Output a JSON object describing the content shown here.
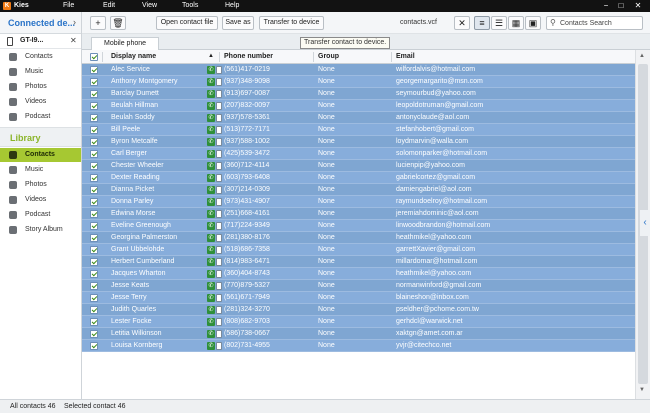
{
  "app": {
    "logo_text": "K",
    "name": "Kies"
  },
  "menu": [
    "File",
    "Edit",
    "View",
    "Tools",
    "Help"
  ],
  "window": {
    "minimize": "−",
    "maximize": "□",
    "close": "✕"
  },
  "sidebar": {
    "connected_title": "Connected de...",
    "device_name": "GT-I9...",
    "device_items": [
      "Contacts",
      "Music",
      "Photos",
      "Videos",
      "Podcast"
    ],
    "library_title": "Library",
    "library_items": [
      "Contacts",
      "Music",
      "Photos",
      "Videos",
      "Podcast",
      "Story Album"
    ]
  },
  "toolbar": {
    "add": "+",
    "delete": "🗑",
    "open_contact_file": "Open contact file",
    "save_as": "Save as",
    "transfer_to_device": "Transfer to device",
    "file_name": "contacts.vcf",
    "search_placeholder": "Contacts Search"
  },
  "tooltip": "Transfer contact to device.",
  "tab": "Mobile phone",
  "table": {
    "headers": {
      "display_name": "Display name",
      "phone_number": "Phone number",
      "group": "Group",
      "email": "Email"
    },
    "rows": [
      {
        "name": "Alec Service",
        "phone": "(561)417-0219",
        "group": "None",
        "email": "wilfordalvis@hotmail.com"
      },
      {
        "name": "Anthony Montgomery",
        "phone": "(937)348-9098",
        "group": "None",
        "email": "georgemargarito@msn.com"
      },
      {
        "name": "Barclay Dumett",
        "phone": "(913)697-0087",
        "group": "None",
        "email": "seymourbud@yahoo.com"
      },
      {
        "name": "Beulah Hillman",
        "phone": "(207)832-0097",
        "group": "None",
        "email": "leopoldotruman@gmail.com"
      },
      {
        "name": "Beulah Soddy",
        "phone": "(937)578-5361",
        "group": "None",
        "email": "antonyclaude@aol.com"
      },
      {
        "name": "Bill Peele",
        "phone": "(513)772-7171",
        "group": "None",
        "email": "stefanhobert@gmail.com"
      },
      {
        "name": "Byron Metcalfe",
        "phone": "(937)588-1002",
        "group": "None",
        "email": "loydmarvin@walla.com"
      },
      {
        "name": "Carl Berger",
        "phone": "(425)539-3472",
        "group": "None",
        "email": "solomonparker@hotmail.com"
      },
      {
        "name": "Chester Wheeler",
        "phone": "(360)712-4114",
        "group": "None",
        "email": "lucienpip@yahoo.com"
      },
      {
        "name": "Dexter Reading",
        "phone": "(603)793-6408",
        "group": "None",
        "email": "gabrielcortez@gmail.com"
      },
      {
        "name": "Dianna Picket",
        "phone": "(307)214-0309",
        "group": "None",
        "email": "damiengabriel@aol.com"
      },
      {
        "name": "Donna Parley",
        "phone": "(973)431-4907",
        "group": "None",
        "email": "raymundoelroy@hotmail.com"
      },
      {
        "name": "Edwina Morse",
        "phone": "(251)668-4161",
        "group": "None",
        "email": "jeremiahdominic@aol.com"
      },
      {
        "name": "Eveline Greenough",
        "phone": "(717)224-9349",
        "group": "None",
        "email": "linwoodbrandon@hotmail.com"
      },
      {
        "name": "Georgina Palmerston",
        "phone": "(281)380-8176",
        "group": "None",
        "email": "heathmikel@yahoo.com"
      },
      {
        "name": "Grant Ubbelohde",
        "phone": "(518)686-7358",
        "group": "None",
        "email": "garrettXavier@gmail.com"
      },
      {
        "name": "Herbert Cumberland",
        "phone": "(814)983-6471",
        "group": "None",
        "email": "millardomar@hotmail.com"
      },
      {
        "name": "Jacques Wharton",
        "phone": "(360)404-8743",
        "group": "None",
        "email": "heathmikel@yahoo.com"
      },
      {
        "name": "Jesse Keats",
        "phone": "(770)879-5327",
        "group": "None",
        "email": "normanwinford@gmail.com"
      },
      {
        "name": "Jesse Terry",
        "phone": "(561)671-7949",
        "group": "None",
        "email": "blaineshon@inbox.com"
      },
      {
        "name": "Judith Quarles",
        "phone": "(281)324-3270",
        "group": "None",
        "email": "pseldher@pchome.com.tw"
      },
      {
        "name": "Lester Focke",
        "phone": "(808)682-9703",
        "group": "None",
        "email": "gerhdcl@warwick.net"
      },
      {
        "name": "Letitia Wilkinson",
        "phone": "(586)738-0667",
        "group": "None",
        "email": "xaktgn@amet.com.ar"
      },
      {
        "name": "Louisa Kornberg",
        "phone": "(802)731-4955",
        "group": "None",
        "email": "yvjr@citechco.net"
      }
    ]
  },
  "status": {
    "all_contacts": "All contacts 46",
    "selected_contact": "Selected contact 46"
  },
  "colors": {
    "accent_blue": "#2a74c8",
    "library_green": "#a6c832",
    "selection_blue": "#7fa6d2"
  }
}
